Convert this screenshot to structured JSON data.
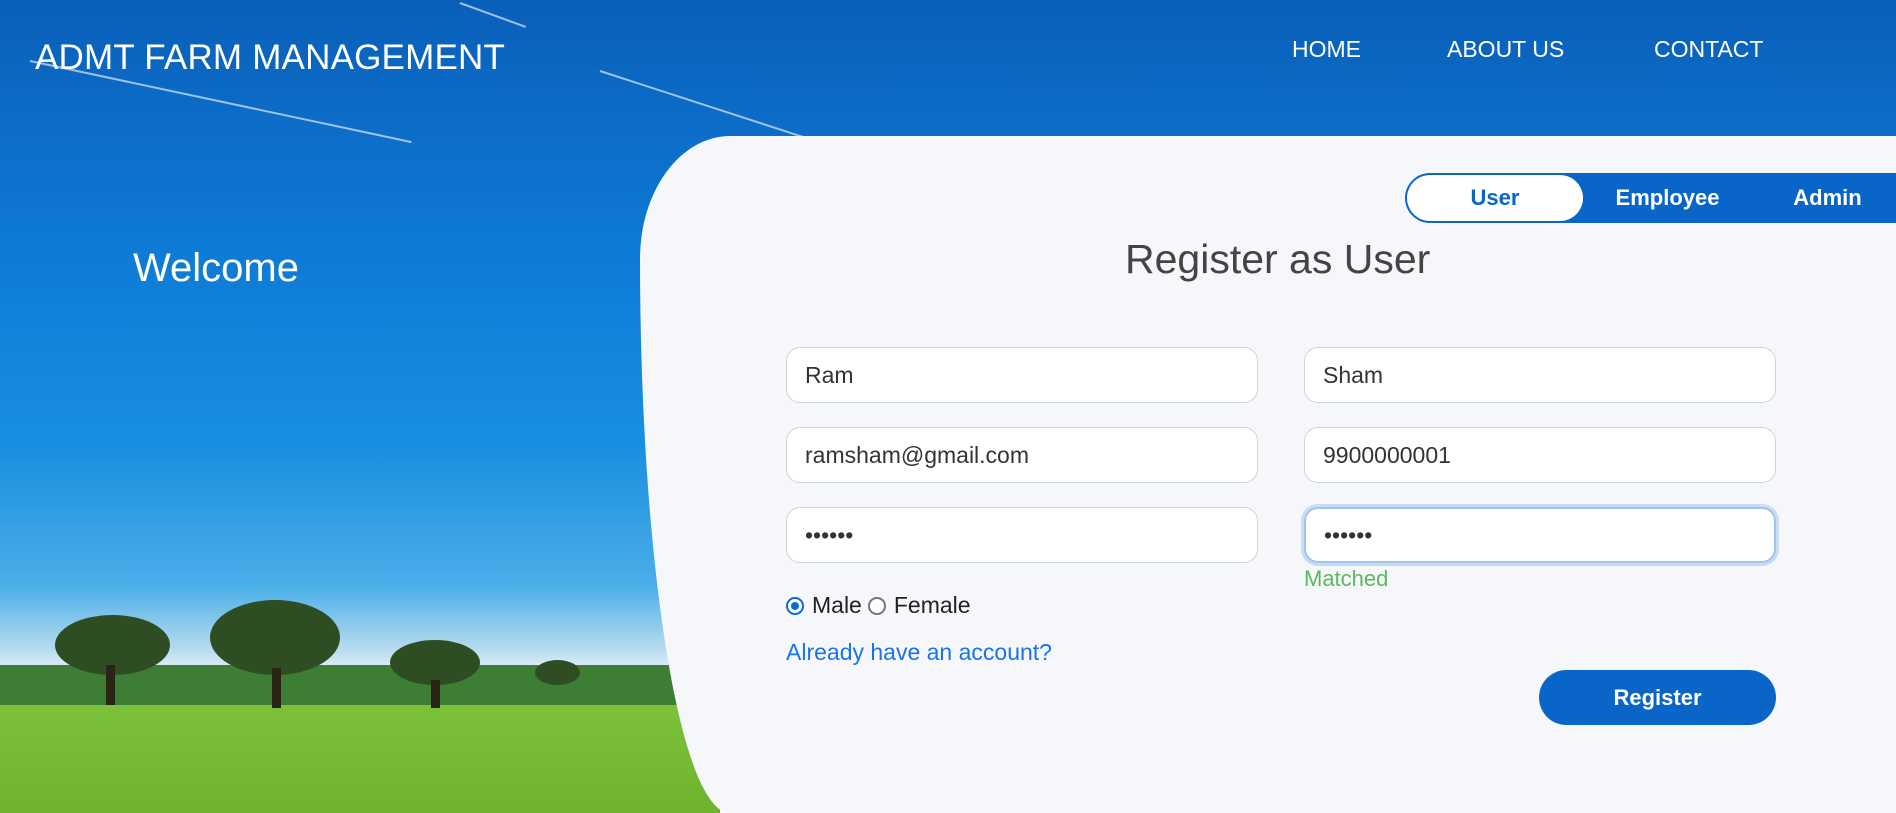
{
  "header": {
    "brand": "ADMT FARM MANAGEMENT",
    "nav": [
      "HOME",
      "ABOUT US",
      "CONTACT"
    ]
  },
  "hero": {
    "welcome": "Welcome"
  },
  "role_toggle": {
    "options": [
      "User",
      "Employee",
      "Admin"
    ],
    "selected": "User"
  },
  "form": {
    "title": "Register as User",
    "first_name": "Ram",
    "last_name": "Sham",
    "email": "ramsham@gmail.com",
    "phone": "9900000001",
    "password": "••••••",
    "confirm_password": "••••••",
    "match_status": "Matched",
    "gender_options": [
      "Male",
      "Female"
    ],
    "gender_selected": "Male",
    "login_link": "Already have an account?",
    "submit_label": "Register"
  },
  "colors": {
    "primary": "#0966c8",
    "success": "#5cb85c",
    "link": "#1a73e8",
    "panel": "#f5f7fa"
  }
}
